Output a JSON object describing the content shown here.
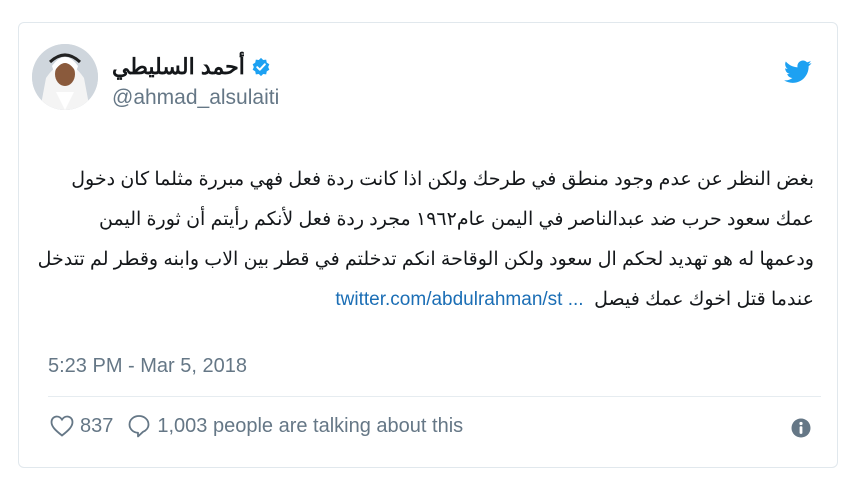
{
  "author": {
    "name": "أحمد السليطي",
    "handle": "@ahmad_alsulaiti"
  },
  "tweet": {
    "lines": [
      "بغض النظر عن عدم وجود منطق في طرحك ولكن اذا كانت ردة فعل فهي مبررة مثلما كان دخول",
      "عمك سعود حرب ضد عبدالناصر في اليمن عام١٩٦٢ مجرد ردة فعل لأنكم رأيتم أن ثورة اليمن",
      "ودعمها له هو تهديد لحكم ال سعود ولكن الوقاحة انكم تدخلتم في قطر بين الاب وابنه وقطر لم تتدخل",
      "عندما قتل اخوك عمك فيصل"
    ],
    "link": "twitter.com/abdulrahman/st ..."
  },
  "timestamp": "5:23 PM - Mar 5, 2018",
  "stats": {
    "likes": "837",
    "talking": "1,003 people are talking about this"
  },
  "colors": {
    "brand": "#1da1f2",
    "link": "#1b6eb5",
    "muted": "#657786"
  },
  "icons": [
    "verified-badge-icon",
    "twitter-bird-icon",
    "heart-icon",
    "speech-bubble-icon",
    "info-icon"
  ]
}
